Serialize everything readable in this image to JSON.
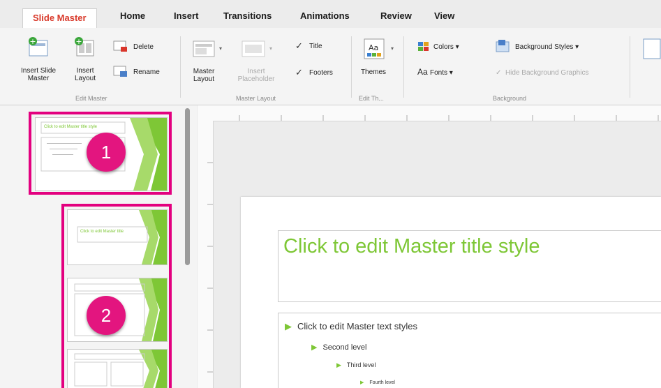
{
  "tabs": [
    "Slide Master",
    "Home",
    "Insert",
    "Transitions",
    "Animations",
    "Review",
    "View"
  ],
  "ribbon": {
    "edit_master": {
      "insert_slide_master": "Insert Slide Master",
      "insert_layout": "Insert Layout",
      "delete": "Delete",
      "rename": "Rename",
      "group_label": "Edit Master"
    },
    "master_layout": {
      "master_layout": "Master Layout",
      "insert_placeholder": "Insert Placeholder",
      "title": "Title",
      "footers": "Footers",
      "title_checked": true,
      "footers_checked": true,
      "group_label": "Master Layout"
    },
    "edit_theme": {
      "themes": "Themes",
      "group_label": "Edit Th..."
    },
    "background": {
      "colors": "Colors",
      "fonts": "Fonts",
      "background_styles": "Background Styles",
      "hide_background_graphics": "Hide Background Graphics",
      "group_label": "Background"
    }
  },
  "slide": {
    "title": "Click to edit Master title style",
    "levels": [
      "Click to edit Master text styles",
      "Second level",
      "Third level",
      "Fourth level"
    ]
  },
  "thumbnails": {
    "master_title": "Click to edit Master title style",
    "layout_title": "Click to edit Master title"
  },
  "callouts": [
    "1",
    "2"
  ],
  "colors": {
    "accent": "#7ec736",
    "callout": "#e3007f",
    "active_tab": "#d93a2b"
  }
}
